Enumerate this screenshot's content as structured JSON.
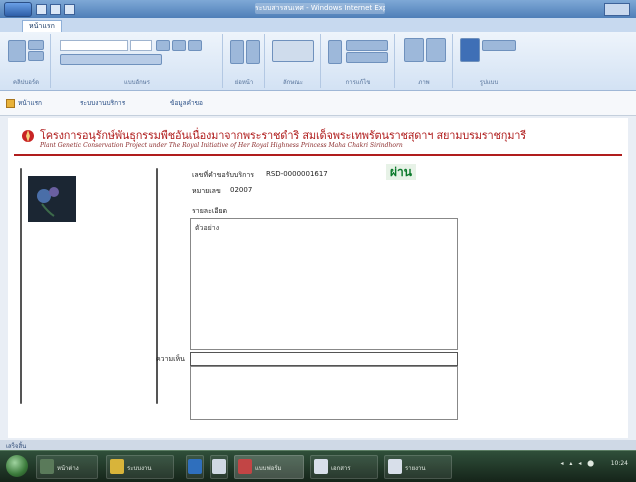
{
  "window": {
    "title": "ระบบสารสนเทศ - Windows Internet Explorer"
  },
  "ribbon": {
    "tabs": [
      "หน้าแรก"
    ],
    "groups": [
      "คลิปบอร์ด",
      "แบบอักษร",
      "ย่อหน้า",
      "ลักษณะ",
      "การแก้ไข",
      "ภาพ",
      "รูปแบบ"
    ]
  },
  "breadcrumb": {
    "items": [
      "หน้าแรก",
      "ระบบงานบริการ",
      "ข้อมูลคำขอ"
    ]
  },
  "banner": {
    "title": "โครงการอนุรักษ์พันธุกรรมพืชอันเนื่องมาจากพระราชดำริ สมเด็จพระเทพรัตนราชสุดาฯ สยามบรมราชกุมารี",
    "subtitle": "Plant Genetic Conservation Project under The Royal Initiative of Her Royal Highness Princess Maha Chakri Sirindhorn"
  },
  "form": {
    "request_label": "เลขที่คำขอรับบริการ",
    "request_value": "RSD-0000001617",
    "number_label": "หมายเลข",
    "number_value": "02007",
    "detail_label": "รายละเอียด",
    "detail_text": "ตัวอย่าง",
    "comment_label": "ความเห็น",
    "stamp": "ผ่าน"
  },
  "status": {
    "text": "เสร็จสิ้น"
  },
  "taskbar": {
    "items": [
      "หน้าต่าง",
      "ระบบงาน",
      "แบบฟอร์ม",
      "เอกสาร",
      "รายงาน"
    ],
    "clock": "10:24"
  }
}
